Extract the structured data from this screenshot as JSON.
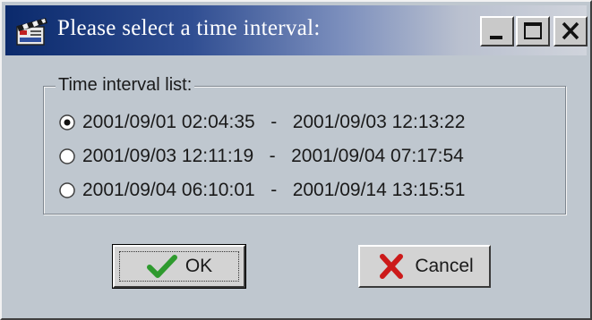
{
  "window": {
    "title": "Please select a time interval:",
    "icon": "clapperboard-icon",
    "controls": [
      "minimize-icon",
      "maximize-icon",
      "close-icon"
    ]
  },
  "group": {
    "label": "Time interval list:",
    "intervals": [
      {
        "start": "2001/09/01 02:04:35",
        "separator": "-",
        "end": "2001/09/03 12:13:22",
        "selected": true
      },
      {
        "start": "2001/09/03 12:11:19",
        "separator": "-",
        "end": "2001/09/04 07:17:54",
        "selected": false
      },
      {
        "start": "2001/09/04 06:10:01",
        "separator": "-",
        "end": "2001/09/14 13:15:51",
        "selected": false
      }
    ]
  },
  "buttons": {
    "ok_label": "OK",
    "ok_icon": "checkmark-icon",
    "cancel_label": "Cancel",
    "cancel_icon": "red-x-icon"
  },
  "colors": {
    "dialog_face": "#bfc7cf",
    "titlebar_start": "#0b2a6c",
    "titlebar_end": "#d0d4dc",
    "ok_check": "#2e9a2e",
    "cancel_x": "#cc1a1a"
  }
}
